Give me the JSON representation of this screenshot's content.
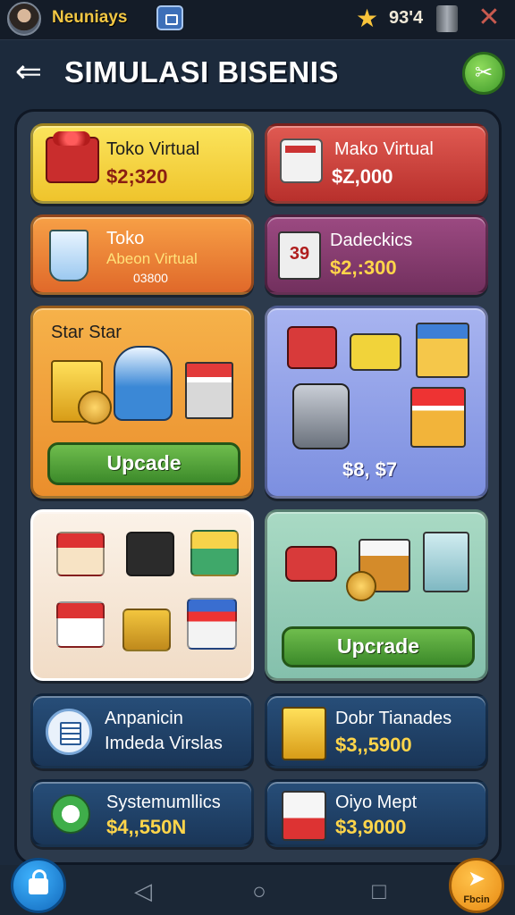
{
  "topbar": {
    "username": "Neuniays",
    "coins": "93'4"
  },
  "header": {
    "title": "SIMULASI BISENIS"
  },
  "cards": {
    "toko_virtual": {
      "name": "Toko Virtual",
      "price": "$2;320"
    },
    "mako_virtual": {
      "name": "Mako Virtual",
      "price": "$Z,000"
    },
    "toko": {
      "name": "Toko",
      "sub": "Abeon Virtual",
      "code": "03800"
    },
    "dadeckics": {
      "name": "Dadeckics",
      "price": "$2,:300",
      "calendar_num": "39"
    },
    "star_star": {
      "name": "Star Star",
      "button": "Upcade"
    },
    "vehicles": {
      "price": "$8, $7"
    },
    "right_upgrade": {
      "button": "Upcrade"
    },
    "anpanicin": {
      "line1": "Anpanicin",
      "line2": "Imdeda Virslas"
    },
    "dobr_tianades": {
      "name": "Dobr Tianades",
      "price": "$3,,5900"
    },
    "systemumllics": {
      "name": "Systemumllics",
      "price": "$4,,550N"
    },
    "oiyo_mept": {
      "name": "Oiyo Mept",
      "price": "$3,9000"
    }
  },
  "bottom": {
    "fab_label": "Fbcin"
  },
  "colors": {
    "yellow": "#f7d43e",
    "red": "#d3423e",
    "orange": "#f0822f",
    "purple": "#8f3f74",
    "blue_panel": "#1f3f63",
    "green_button": "#4fa33a"
  }
}
